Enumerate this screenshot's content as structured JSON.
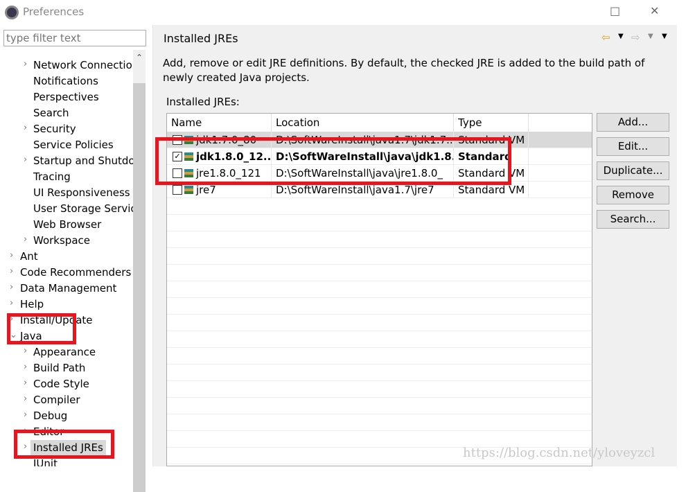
{
  "window": {
    "title": "Preferences",
    "maximize_icon": "□",
    "close_icon": "✕"
  },
  "sidebar": {
    "filter_placeholder": "type filter text",
    "items": [
      {
        "label": "Network Connectio",
        "level": 2,
        "expandable": true
      },
      {
        "label": "Notifications",
        "level": 2,
        "expandable": false
      },
      {
        "label": "Perspectives",
        "level": 2,
        "expandable": false
      },
      {
        "label": "Search",
        "level": 2,
        "expandable": false
      },
      {
        "label": "Security",
        "level": 2,
        "expandable": true
      },
      {
        "label": "Service Policies",
        "level": 2,
        "expandable": false
      },
      {
        "label": "Startup and Shutdo",
        "level": 2,
        "expandable": true
      },
      {
        "label": "Tracing",
        "level": 2,
        "expandable": false
      },
      {
        "label": "UI Responsiveness M",
        "level": 2,
        "expandable": false
      },
      {
        "label": "User Storage Servic",
        "level": 2,
        "expandable": false
      },
      {
        "label": "Web Browser",
        "level": 2,
        "expandable": false
      },
      {
        "label": "Workspace",
        "level": 2,
        "expandable": true
      },
      {
        "label": "Ant",
        "level": 1,
        "expandable": true
      },
      {
        "label": "Code Recommenders",
        "level": 1,
        "expandable": true
      },
      {
        "label": "Data Management",
        "level": 1,
        "expandable": true
      },
      {
        "label": "Help",
        "level": 1,
        "expandable": true
      },
      {
        "label": "Install/Update",
        "level": 1,
        "expandable": true
      },
      {
        "label": "Java",
        "level": 1,
        "expandable": true,
        "expanded": true
      },
      {
        "label": "Appearance",
        "level": 2,
        "expandable": true
      },
      {
        "label": "Build Path",
        "level": 2,
        "expandable": true
      },
      {
        "label": "Code Style",
        "level": 2,
        "expandable": true
      },
      {
        "label": "Compiler",
        "level": 2,
        "expandable": true
      },
      {
        "label": "Debug",
        "level": 2,
        "expandable": true
      },
      {
        "label": "Editor",
        "level": 2,
        "expandable": true
      },
      {
        "label": "Installed JREs",
        "level": 2,
        "expandable": true,
        "selected": true
      },
      {
        "label": "JUnit",
        "level": 2,
        "expandable": false
      }
    ]
  },
  "page": {
    "title": "Installed JREs",
    "nav_icons": [
      "back-arrow-icon",
      "forward-arrow-icon",
      "menu-icon"
    ],
    "description": "Add, remove or edit JRE definitions. By default, the checked JRE is added to the build path of newly created Java projects.",
    "table_label": "Installed JREs:",
    "columns": [
      "Name",
      "Location",
      "Type"
    ],
    "rows": [
      {
        "name": "jdk1.7.0_80",
        "location": "D:\\SoftWareInstall\\java1.7\\jdk1.7...",
        "type": "Standard VM",
        "checked": false,
        "bold": false,
        "highlighted": true
      },
      {
        "name": "jdk1.8.0_12...",
        "location": "D:\\SoftWareInstall\\java\\jdk1.8....",
        "type": "Standard",
        "checked": true,
        "bold": true,
        "highlighted": false
      },
      {
        "name": "jre1.8.0_121",
        "location": "D:\\SoftWareInstall\\java\\jre1.8.0_",
        "type": "Standard VM",
        "checked": false,
        "bold": false,
        "highlighted": false
      },
      {
        "name": "jre7",
        "location": "D:\\SoftWareInstall\\java1.7\\jre7",
        "type": "Standard VM",
        "checked": false,
        "bold": false,
        "highlighted": false
      }
    ],
    "buttons": [
      "Add...",
      "Edit...",
      "Duplicate...",
      "Remove",
      "Search..."
    ]
  },
  "watermark": "https://blog.csdn.net/yloveyzcl",
  "colors": {
    "annotation_red": "#e8141e",
    "selection": "#d9d9d9"
  }
}
